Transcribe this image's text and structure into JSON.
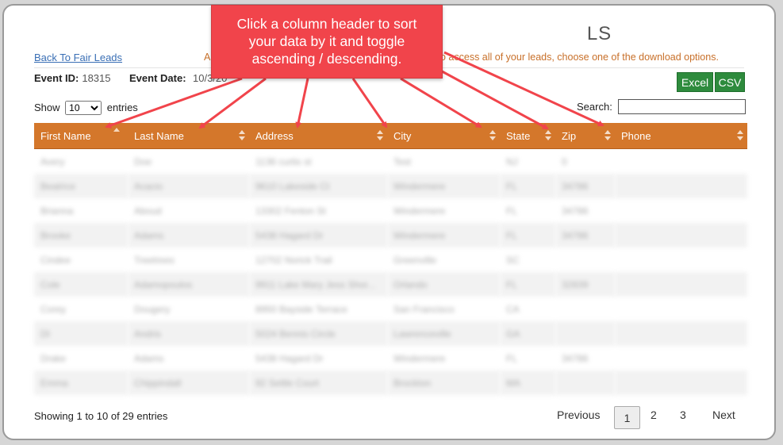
{
  "page": {
    "title_visible": "LS",
    "back_link": "Back To Fair Leads",
    "notice_start": "A",
    "notice_tail": "o access all of your leads, choose one of the download options."
  },
  "event": {
    "id_label": "Event ID:",
    "id_value": "18315",
    "date_label": "Event Date:",
    "date_value": "10/3/20"
  },
  "downloads": {
    "excel": "Excel",
    "csv": "CSV"
  },
  "length": {
    "show": "Show",
    "selected": "10",
    "entries": "entries"
  },
  "search": {
    "label": "Search:",
    "value": ""
  },
  "table": {
    "headers": [
      "First Name",
      "Last Name",
      "Address",
      "City",
      "State",
      "Zip",
      "Phone"
    ],
    "rows": [
      [
        "Avery",
        "Doe",
        "1136 curtis st",
        "Test",
        "NJ",
        "0",
        ""
      ],
      [
        "Beatrice",
        "Acacio",
        "9610 Lakeside Ct",
        "Windermere",
        "FL",
        "34786",
        ""
      ],
      [
        "Brianna",
        "Aboud",
        "13302 Fenton St",
        "Windermere",
        "FL",
        "34786",
        ""
      ],
      [
        "Brooke",
        "Adams",
        "5438 Hagard Dr",
        "Windermere",
        "FL",
        "34786",
        ""
      ],
      [
        "Cindee",
        "Treetrees",
        "12702 Norick Trail",
        "Greenville",
        "SC",
        "",
        ""
      ],
      [
        "Cole",
        "Adamopoulos",
        "9911 Lake Mary Jess Shor...",
        "Orlando",
        "FL",
        "32839",
        ""
      ],
      [
        "Corey",
        "Dougery",
        "8950 Bayside Terrace",
        "San Francisco",
        "CA",
        "",
        ""
      ],
      [
        "DI",
        "Andris",
        "5024 Bennis Circle",
        "Lawrenceville",
        "GA",
        "",
        ""
      ],
      [
        "Drake",
        "Adams",
        "5438 Hagard Dr",
        "Windermere",
        "FL",
        "34786",
        ""
      ],
      [
        "Emma",
        "Chippindall",
        "92 Settle Court",
        "Brockton",
        "MA",
        "",
        ""
      ]
    ]
  },
  "info": "Showing 1 to 10 of 29 entries",
  "pagination": {
    "previous": "Previous",
    "pages": [
      "1",
      "2",
      "3"
    ],
    "next": "Next"
  },
  "callout": {
    "line1": "Click a column header to sort",
    "line2": "your data by it and toggle",
    "line3": "ascending / descending."
  },
  "colors": {
    "header": "#d4772b",
    "callout": "#f1444b",
    "download": "#2e8b3d",
    "link": "#3a6fb5"
  }
}
